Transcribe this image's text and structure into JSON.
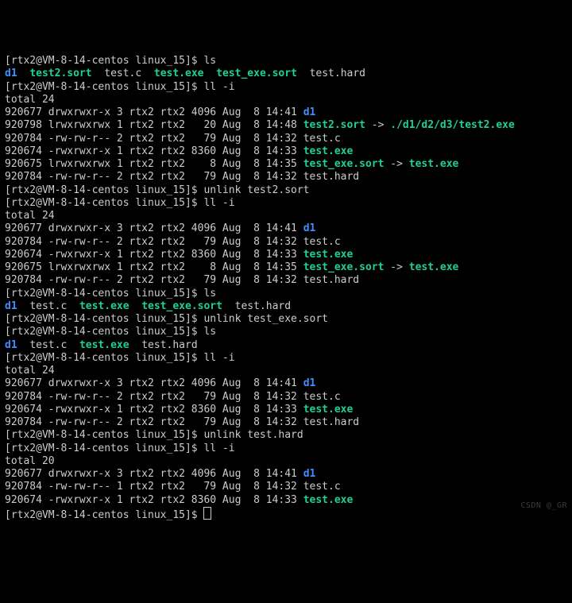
{
  "prompt": "[rtx2@VM-8-14-centos linux_15]$ ",
  "cmds": {
    "ls": "ls",
    "ll_i": "ll -i",
    "unlink_test2_sort": "unlink test2.sort",
    "unlink_test_exe_sort": "unlink test_exe.sort",
    "unlink_test_hard": "unlink test.hard"
  },
  "files": {
    "d1": "d1",
    "test2_sort": "test2.sort",
    "test_c": "test.c",
    "test_exe": "test.exe",
    "test_exe_sort": "test_exe.sort",
    "test_hard": "test.hard",
    "target2": "./d1/d2/d3/test2.exe"
  },
  "sep": " -> ",
  "totals": {
    "t24": "total 24",
    "t20": "total 20"
  },
  "rows": {
    "d1": "920677 drwxrwxr-x 3 rtx2 rtx2 4096 Aug  8 14:41 ",
    "test2_sort": "920798 lrwxrwxrwx 1 rtx2 rtx2   20 Aug  8 14:48 ",
    "test_c_2": "920784 -rw-rw-r-- 2 rtx2 rtx2   79 Aug  8 14:32 ",
    "test_c_1": "920784 -rw-rw-r-- 1 rtx2 rtx2   79 Aug  8 14:32 ",
    "test_exe_1": "920674 -rwxrwxr-x 1 rtx2 rtx2 8360 Aug  8 14:33 ",
    "test_exe_s": "920675 lrwxrwxrwx 1 rtx2 rtx2    8 Aug  8 14:35 ",
    "test_hard_2": "920784 -rw-rw-r-- 2 rtx2 rtx2   79 Aug  8 14:32 "
  },
  "watermark": "CSDN @_GR"
}
